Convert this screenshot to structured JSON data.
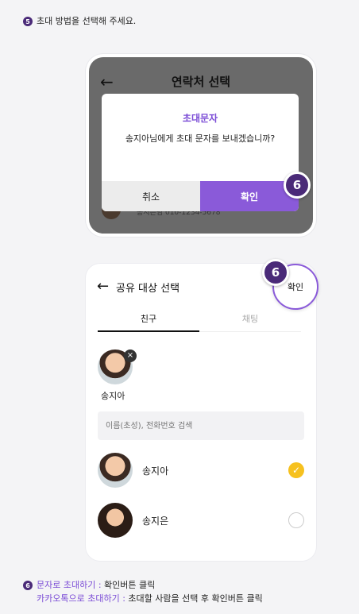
{
  "step5": {
    "num": "5",
    "text": "초대 방법을 선택해 주세요."
  },
  "screen1": {
    "back_icon": "←",
    "title": "연락처 선택",
    "background_row": "송지은님 010-1234-5678",
    "dialog": {
      "title": "초대문자",
      "message": "송지아님에게 초대 문자를 보내겠습니까?",
      "cancel": "취소",
      "confirm": "확인"
    },
    "badge": "6"
  },
  "screen2": {
    "back_icon": "←",
    "title": "공유 대상 선택",
    "confirm": "확인",
    "badge": "6",
    "tabs": [
      "친구",
      "채팅"
    ],
    "selected": {
      "name": "송지아",
      "remove_icon": "×"
    },
    "search_placeholder": "이름(초성), 전화번호 검색",
    "contacts": [
      {
        "name": "송지아",
        "checked": true,
        "check_icon": "✓"
      },
      {
        "name": "송지은",
        "checked": false,
        "check_icon": ""
      }
    ]
  },
  "footer": {
    "num": "6",
    "line1_highlight": "문자로 초대하기 : ",
    "line1_text": "확인버튼 클릭",
    "line2_highlight": "카카오톡으로 초대하기 : ",
    "line2_text": "초대할 사람을 선택 후 확인버튼 클릭"
  },
  "colors": {
    "accent": "#8a5ad9",
    "badge": "#4a2a78",
    "check": "#f6c11f"
  }
}
